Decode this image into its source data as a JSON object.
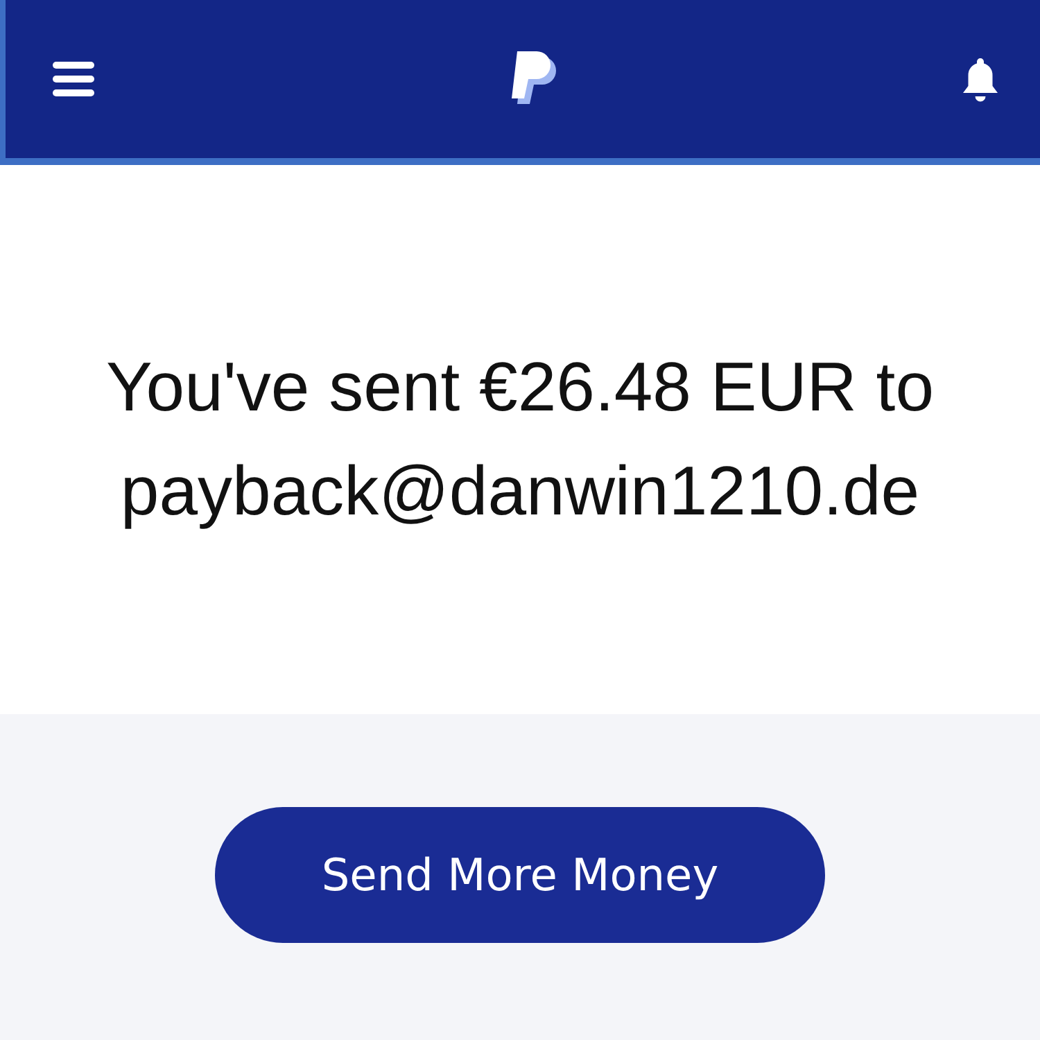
{
  "message": "You've sent €26.48 EUR to payback@danwin1210.de",
  "button": "Send More Money"
}
